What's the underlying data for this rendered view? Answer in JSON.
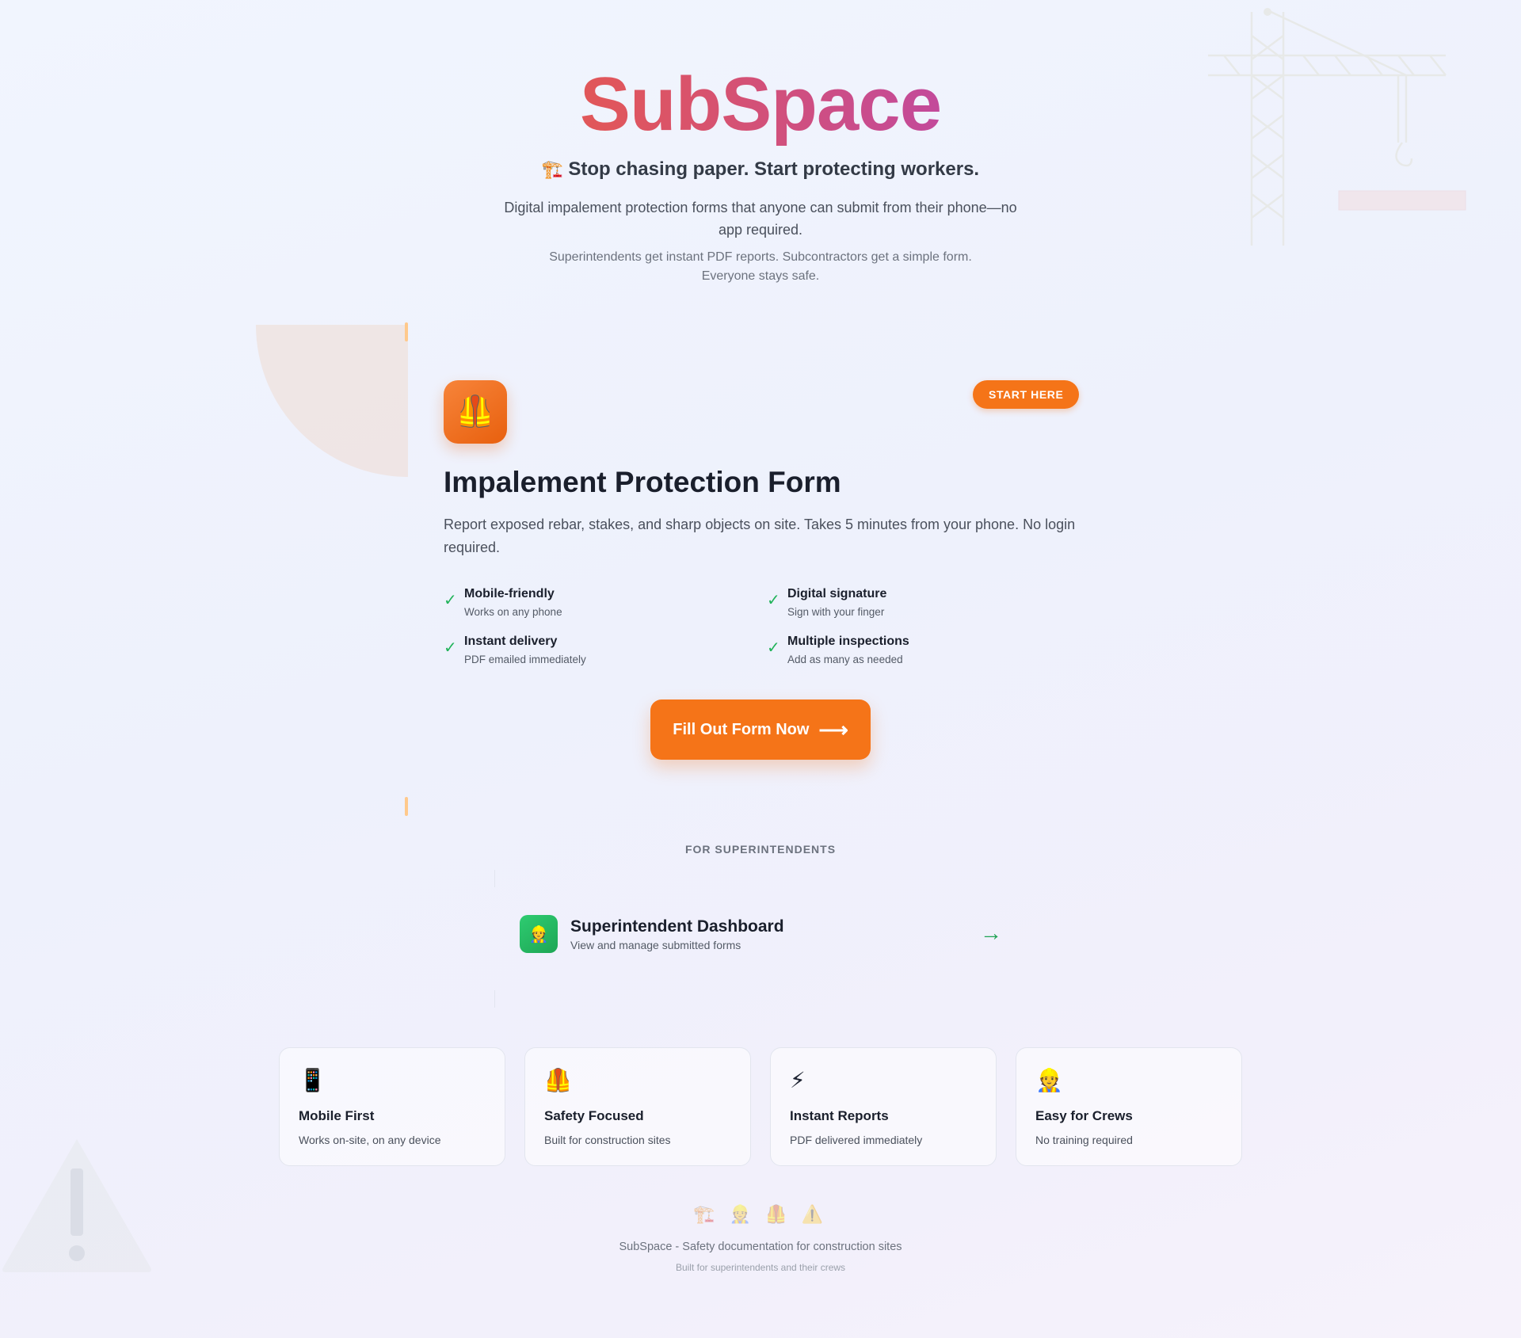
{
  "hero": {
    "logo": "SubSpace",
    "tagline_icon": "🏗️",
    "tagline": "Stop chasing paper. Start protecting workers.",
    "description": "Digital impalement protection forms that anyone can submit from their phone—no app required.",
    "subdescription": "Superintendents get instant PDF reports. Subcontractors get a simple form. Everyone stays safe."
  },
  "form_card": {
    "icon": "🦺",
    "badge": "START HERE",
    "title": "Impalement Protection Form",
    "description": "Report exposed rebar, stakes, and sharp objects on site. Takes 5 minutes from your phone. No login required.",
    "features": [
      {
        "check": "✓",
        "title": "Mobile-friendly",
        "desc": "Works on any phone"
      },
      {
        "check": "✓",
        "title": "Digital signature",
        "desc": "Sign with your finger"
      },
      {
        "check": "✓",
        "title": "Instant delivery",
        "desc": "PDF emailed immediately"
      },
      {
        "check": "✓",
        "title": "Multiple inspections",
        "desc": "Add as many as needed"
      }
    ],
    "cta_label": "Fill Out Form Now",
    "cta_arrow": "⟶"
  },
  "superintendents": {
    "section_label": "FOR SUPERINTENDENTS",
    "dashboard": {
      "icon": "👷",
      "title": "Superintendent Dashboard",
      "subtitle": "View and manage submitted forms",
      "arrow": "→"
    }
  },
  "cards": [
    {
      "icon": "📱",
      "title": "Mobile First",
      "desc": "Works on-site, on any device"
    },
    {
      "icon": "🦺",
      "title": "Safety Focused",
      "desc": "Built for construction sites"
    },
    {
      "icon": "⚡",
      "title": "Instant Reports",
      "desc": "PDF delivered immediately"
    },
    {
      "icon": "👷",
      "title": "Easy for Crews",
      "desc": "No training required"
    }
  ],
  "footer": {
    "icons": "🏗️ 👷 🦺 ⚠️",
    "main": "SubSpace - Safety documentation for construction sites",
    "sub": "Built for superintendents and their crews"
  },
  "colors": {
    "accent_orange": "#f57418",
    "success_green": "#21b35a",
    "logo_gradient_start": "#f26f1e",
    "logo_gradient_end": "#9a3fe6"
  }
}
